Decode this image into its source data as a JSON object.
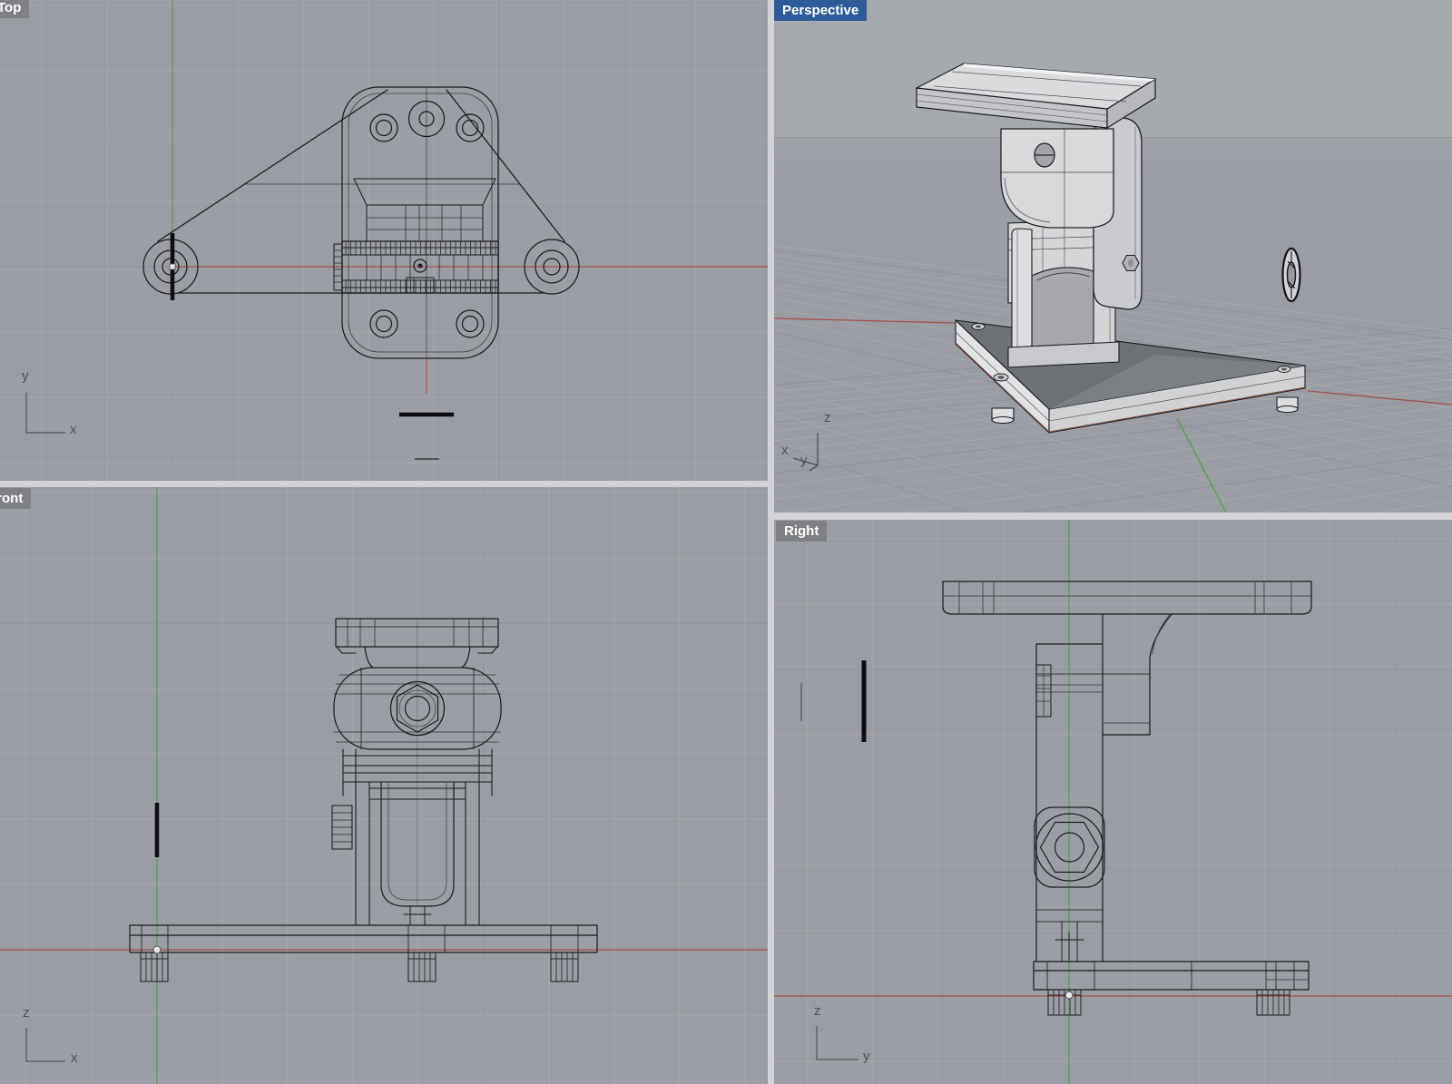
{
  "window": {
    "app_type": "cad-4-viewport-layout",
    "active_viewport": "Perspective"
  },
  "colors": {
    "viewport_bg": "#9a9da3",
    "perspective_sky": "#a6a9ae",
    "perspective_ground": "#9a9da3",
    "grid_minor": "#a5a8ae",
    "grid_major": "#8f929a",
    "divider": "#d3d4d6",
    "axis_x_red": "#a8514b",
    "axis_y_green": "#58a055",
    "label_active_bg": "#2e5c9a",
    "label_inactive_bg": "#7e8084",
    "label_text": "#ffffff",
    "wireframe": "#1b1c1e",
    "shaded_fill": "#d7d9db",
    "base_top_fill": "#6e7175"
  },
  "viewports": {
    "top": {
      "label": "Top",
      "axis_vertical": "y",
      "axis_horizontal": "x"
    },
    "perspective": {
      "label": "Perspective",
      "axis_up": "z",
      "axis_left": "x",
      "axis_front": "y"
    },
    "front": {
      "label": "Front",
      "axis_vertical": "z",
      "axis_horizontal": "x"
    },
    "right": {
      "label": "Right",
      "axis_vertical": "z",
      "axis_horizontal": "y"
    }
  }
}
